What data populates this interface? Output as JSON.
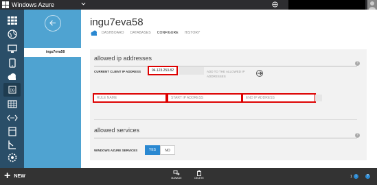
{
  "topbar": {
    "brand": "Windows Azure"
  },
  "rail": {
    "items": [
      "grid-icon",
      "globe-icon",
      "monitor-icon",
      "mobile-icon",
      "cloud-service-icon",
      "database-icon",
      "table-icon",
      "code-icon",
      "storage-icon",
      "media-icon",
      "settings-icon"
    ],
    "active": "database-icon"
  },
  "sidebar": {
    "items": [
      {
        "label": "ingu7eva58"
      }
    ]
  },
  "page": {
    "title": "ingu7eva58",
    "tabs": [
      {
        "label": "DASHBOARD"
      },
      {
        "label": "DATABASES"
      },
      {
        "label": "CONFIGURE",
        "selected": true
      },
      {
        "label": "HISTORY"
      }
    ]
  },
  "ip_section": {
    "title": "allowed ip addresses",
    "current_ip_label": "CURRENT CLIENT IP ADDRESS",
    "current_ip": "94.123.253.82",
    "add_text": "ADD TO THE ALLOWED IP ADDRESSES",
    "rule_name_placeholder": "RULE NAME",
    "start_ip_placeholder": "START IP ADDRESS",
    "end_ip_placeholder": "END IP ADDRESS"
  },
  "services_section": {
    "title": "allowed services",
    "label": "WINDOWS AZURE SERVICES",
    "yes": "YES",
    "no": "NO",
    "selected": "YES"
  },
  "bottom": {
    "new": "NEW",
    "actions": [
      {
        "label": "MANAGE"
      },
      {
        "label": "DELETE"
      }
    ],
    "notification_count": "1"
  },
  "colors": {
    "highlight": "#dd0000",
    "accent": "#2a88d1",
    "sidebar": "#4fa3d1",
    "rail": "#2a4e68"
  }
}
